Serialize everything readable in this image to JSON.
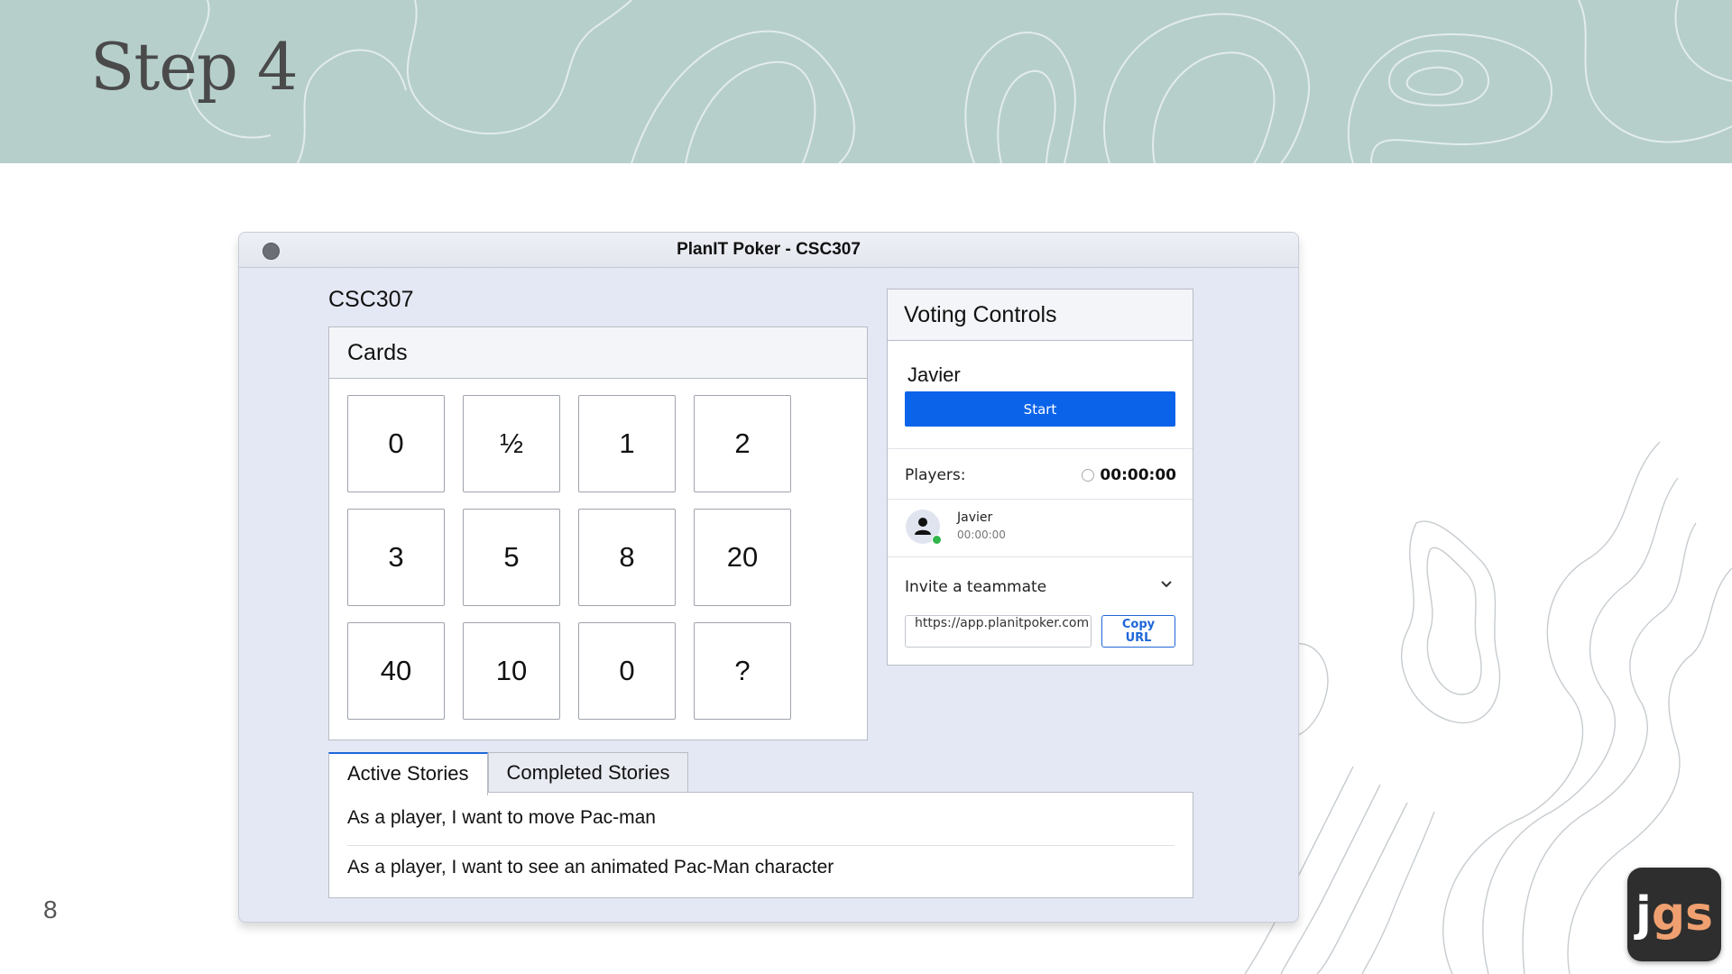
{
  "slide": {
    "title": "Step 4",
    "page_number": "8",
    "logo": {
      "j": "j",
      "gs": "gs"
    }
  },
  "window": {
    "title": "PlanIT Poker - CSC307"
  },
  "room": {
    "name": "CSC307"
  },
  "cards_panel": {
    "title": "Cards",
    "cards": [
      "0",
      "½",
      "1",
      "2",
      "3",
      "5",
      "8",
      "20",
      "40",
      "10",
      "0",
      "?"
    ]
  },
  "voting": {
    "title": "Voting Controls",
    "user": "Javier",
    "start_label": "Start",
    "players_label": "Players:",
    "timer": "00:00:00",
    "player": {
      "name": "Javier",
      "time": "00:00:00"
    },
    "invite_label": "Invite a teammate",
    "invite_url": "https://app.planitpoker.com",
    "copy_label": "Copy URL"
  },
  "stories": {
    "tabs": [
      "Active Stories",
      "Completed Stories"
    ],
    "items": [
      "As a player, I want to move Pac-man",
      "As a player, I want to see an animated Pac-Man character"
    ]
  },
  "colors": {
    "banner": "#b6cfcb",
    "accent": "#0b63ea",
    "online": "#2fb54a"
  }
}
